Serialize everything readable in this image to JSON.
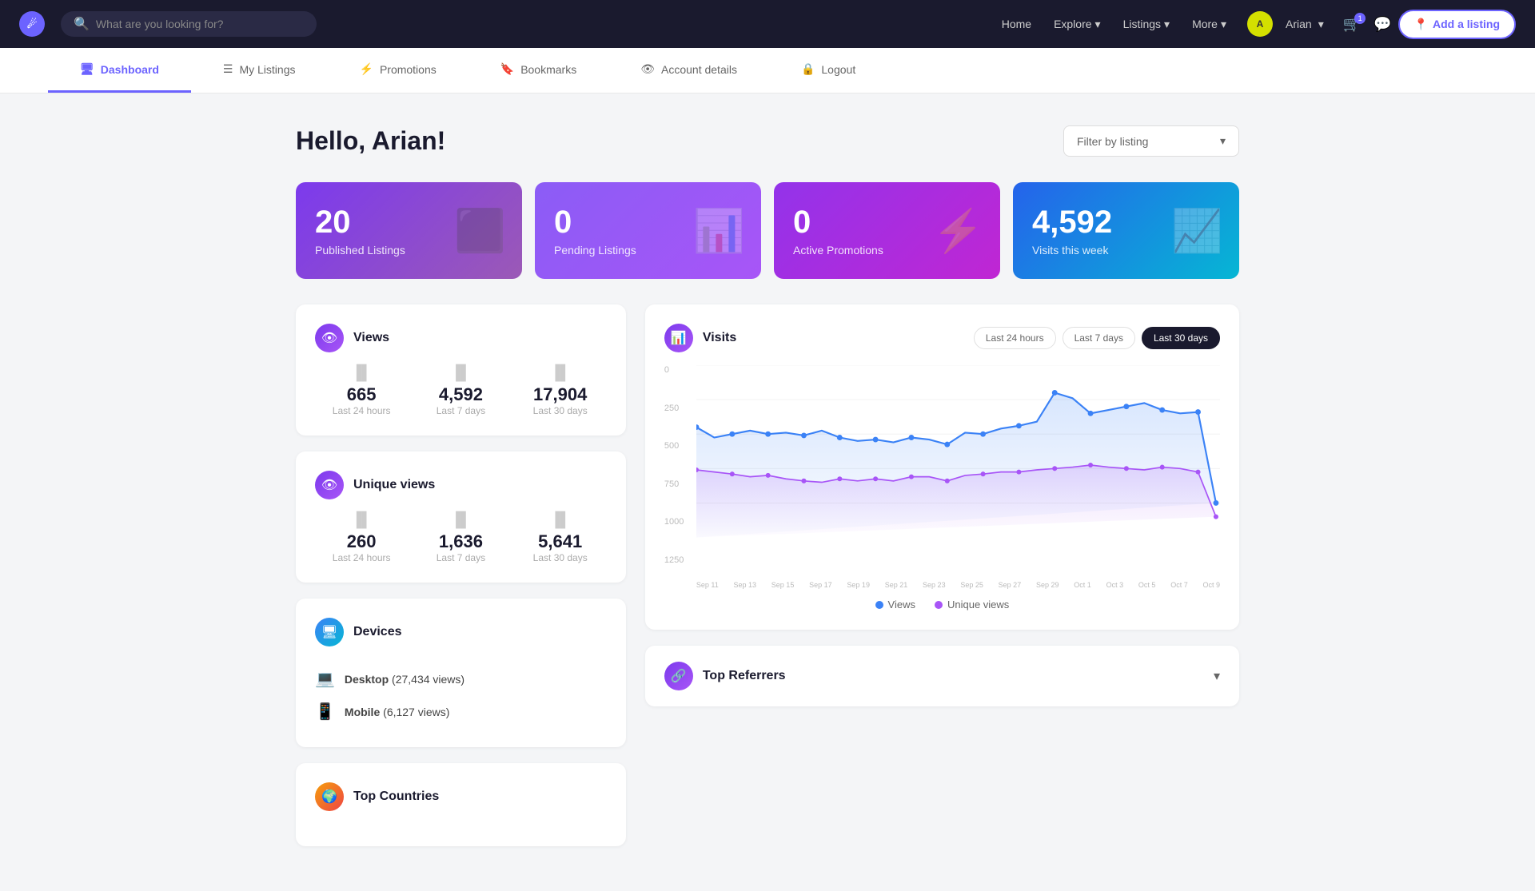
{
  "topNav": {
    "logo": "☄",
    "searchPlaceholder": "What are you looking for?",
    "links": [
      {
        "label": "Home",
        "hasDropdown": false
      },
      {
        "label": "Explore",
        "hasDropdown": true
      },
      {
        "label": "Listings",
        "hasDropdown": true
      },
      {
        "label": "More",
        "hasDropdown": true
      }
    ],
    "user": {
      "initials": "A",
      "name": "Arian",
      "avatarBg": "#d4e000"
    },
    "addListingBtn": "Add a listing",
    "cartCount": "1"
  },
  "subNav": {
    "items": [
      {
        "label": "Dashboard",
        "icon": "🖥",
        "active": true
      },
      {
        "label": "My Listings",
        "icon": "☰",
        "active": false
      },
      {
        "label": "Promotions",
        "icon": "⚡",
        "active": false
      },
      {
        "label": "Bookmarks",
        "icon": "🔖",
        "active": false
      },
      {
        "label": "Account details",
        "icon": "👁",
        "active": false
      },
      {
        "label": "Logout",
        "icon": "🔒",
        "active": false
      }
    ]
  },
  "page": {
    "greeting": "Hello, Arian!",
    "filterLabel": "Filter by listing"
  },
  "statsCards": [
    {
      "number": "20",
      "label": "Published Listings",
      "icon": "⬛",
      "colorClass": "stat-card-purple"
    },
    {
      "number": "0",
      "label": "Pending Listings",
      "icon": "📊",
      "colorClass": "stat-card-violet"
    },
    {
      "number": "0",
      "label": "Active Promotions",
      "icon": "⚡",
      "colorClass": "stat-card-magenta"
    },
    {
      "number": "4,592",
      "label": "Visits this week",
      "icon": "📈",
      "colorClass": "stat-card-blue"
    }
  ],
  "viewsPanel": {
    "title": "Views",
    "stats": [
      {
        "value": "665",
        "period": "Last 24 hours"
      },
      {
        "value": "4,592",
        "period": "Last 7 days"
      },
      {
        "value": "17,904",
        "period": "Last 30 days"
      }
    ]
  },
  "uniqueViewsPanel": {
    "title": "Unique views",
    "stats": [
      {
        "value": "260",
        "period": "Last 24 hours"
      },
      {
        "value": "1,636",
        "period": "Last 7 days"
      },
      {
        "value": "5,641",
        "period": "Last 30 days"
      }
    ]
  },
  "devicesPanel": {
    "title": "Devices",
    "items": [
      {
        "label": "Desktop",
        "views": "27,434 views",
        "icon": "💻"
      },
      {
        "label": "Mobile",
        "views": "6,127 views",
        "icon": "📱"
      }
    ]
  },
  "topCountriesPanel": {
    "title": "Top Countries"
  },
  "visitsChart": {
    "title": "Visits",
    "timeFilters": [
      "Last 24 hours",
      "Last 7 days",
      "Last 30 days"
    ],
    "activeFilter": "Last 30 days",
    "yLabels": [
      "0",
      "250",
      "500",
      "750",
      "1000",
      "1250"
    ],
    "xLabels": [
      "Sep 11",
      "Sep 13",
      "Sep 15",
      "Sep 17",
      "Sep 19",
      "Sep 21",
      "Sep 23",
      "Sep 25",
      "Sep 27",
      "Sep 29",
      "Oct 1",
      "Oct 3",
      "Oct 5",
      "Oct 7",
      "Oct 9"
    ],
    "legend": [
      {
        "label": "Views",
        "color": "#3b82f6"
      },
      {
        "label": "Unique views",
        "color": "#a855f7"
      }
    ]
  },
  "topReferrers": {
    "title": "Top Referrers"
  }
}
